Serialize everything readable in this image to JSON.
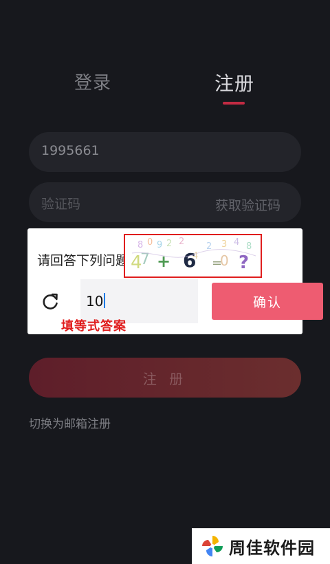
{
  "tabs": {
    "login": "登录",
    "register": "注册"
  },
  "form": {
    "phone_value": "1995661",
    "code_placeholder": "验证码",
    "get_code_label": "获取验证码",
    "submit_label": "注 册",
    "switch_label": "切换为邮箱注册"
  },
  "captcha": {
    "question_label": "请回答下列问题",
    "image_text": "+ 6 ?",
    "answer_value": "10",
    "confirm_label": "确认",
    "annotation": "填等式答案"
  },
  "watermark": {
    "text": "周佳软件园"
  },
  "colors": {
    "accent": "#c22b43",
    "confirm": "#ee5c71",
    "annotation": "#e01d1d",
    "background": "#17181d"
  }
}
